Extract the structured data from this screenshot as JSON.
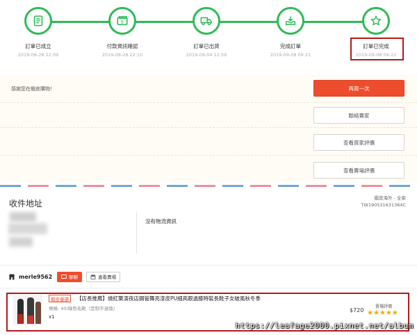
{
  "steps": [
    {
      "label": "訂單已成立",
      "time": "2019-08-28 22:09",
      "icon": "receipt-icon"
    },
    {
      "label": "付款資訊確認",
      "time": "2019-08-28 22:10",
      "icon": "payment-icon"
    },
    {
      "label": "訂單已出貨",
      "time": "2019-09-04 12:59",
      "icon": "truck-icon"
    },
    {
      "label": "完成訂單",
      "time": "2019-09-08 09:21",
      "icon": "inbox-download-icon"
    },
    {
      "label": "訂單已完成",
      "time": "2019-09-08 09:22",
      "icon": "star-icon"
    }
  ],
  "actions": {
    "thanks": "感謝您在蝦皮購物！",
    "buy_again": "再買一次",
    "contact_seller": "聯絡賣家",
    "view_buyer_rating": "查看買家評價",
    "view_store_rating": "查看賣場評價"
  },
  "address": {
    "title": "收件地址",
    "logistics_line1": "蝦皮海外 - 全家",
    "logistics_line2": "TW190531631364C",
    "no_logistics": "沒有物流資訊"
  },
  "shop": {
    "name": "merle9562",
    "chat_label": "聊聊",
    "store_label": "查看賣場"
  },
  "product": {
    "badge": "蝦皮優選",
    "title": "【店長推薦】燒紅葉演夜店鋼管舞亮漆皮PU細高跟過膝時裝長靴子女破風秋冬季",
    "spec": "規格: 40/綠色毛靴（定制不退換）",
    "qty": "x1",
    "price": "$720",
    "rating_label": "賣場評價",
    "rating_stars": 5
  },
  "watermark": "https://leafage2000.pixnet.net/album",
  "colors": {
    "accent_green": "#2dbb55",
    "shopee_orange": "#ee4d2d",
    "highlight_red": "#b3181c",
    "star": "#f6a700"
  }
}
